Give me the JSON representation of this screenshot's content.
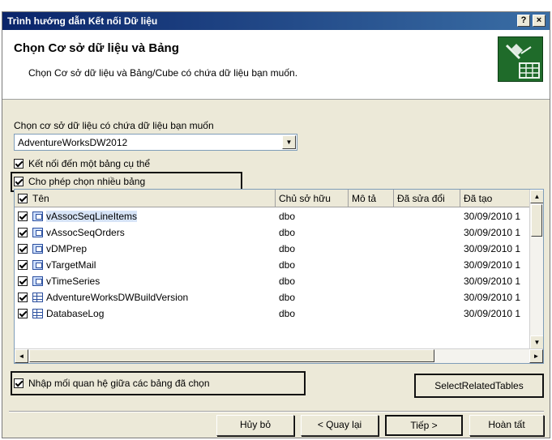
{
  "window": {
    "title": "Trình hướng dẫn Kết nối Dữ liệu",
    "help_button": "?",
    "close_button": "×"
  },
  "header": {
    "title": "Chọn Cơ sở dữ liệu và Bảng",
    "subtitle": "Chọn Cơ sở dữ liệu và Bảng/Cube có chứa dữ liệu bạn muốn."
  },
  "database": {
    "label": "Chọn cơ sở dữ liệu có chứa dữ liệu bạn muốn",
    "selected": "AdventureWorksDW2012"
  },
  "options": {
    "connect_specific_table": "Kết nối đến một bảng cụ thể",
    "allow_multiple_tables": "Cho phép chọn nhiều bảng"
  },
  "table": {
    "columns": [
      "Tên",
      "Chủ sở hữu",
      "Mô tả",
      "Đã sửa đổi",
      "Đã tạo"
    ],
    "rows": [
      {
        "name": "vAssocSeqLineItems",
        "owner": "dbo",
        "description": "",
        "modified": "",
        "created": "30/09/2010 1",
        "type": "view-icon",
        "checked": true
      },
      {
        "name": "vAssocSeqOrders",
        "owner": "dbo",
        "description": "",
        "modified": "",
        "created": "30/09/2010 1",
        "type": "view-icon",
        "checked": true
      },
      {
        "name": "vDMPrep",
        "owner": "dbo",
        "description": "",
        "modified": "",
        "created": "30/09/2010 1",
        "type": "view-icon",
        "checked": true
      },
      {
        "name": "vTargetMail",
        "owner": "dbo",
        "description": "",
        "modified": "",
        "created": "30/09/2010 1",
        "type": "view-icon",
        "checked": true
      },
      {
        "name": "vTimeSeries",
        "owner": "dbo",
        "description": "",
        "modified": "",
        "created": "30/09/2010 1",
        "type": "view-icon",
        "checked": true
      },
      {
        "name": "AdventureWorksDWBuildVersion",
        "owner": "dbo",
        "description": "",
        "modified": "",
        "created": "30/09/2010 1",
        "type": "table-icon",
        "checked": true
      },
      {
        "name": "DatabaseLog",
        "owner": "dbo",
        "description": "",
        "modified": "",
        "created": "30/09/2010 1",
        "type": "table-icon",
        "checked": true
      }
    ]
  },
  "import_relationships": "Nhập mối quan hệ giữa các bảng đã chọn",
  "buttons": {
    "select_related": "SelectRelatedTables",
    "cancel": "Hủy bỏ",
    "back": "< Quay lại",
    "next": "Tiếp >",
    "finish": "Hoàn tất"
  }
}
